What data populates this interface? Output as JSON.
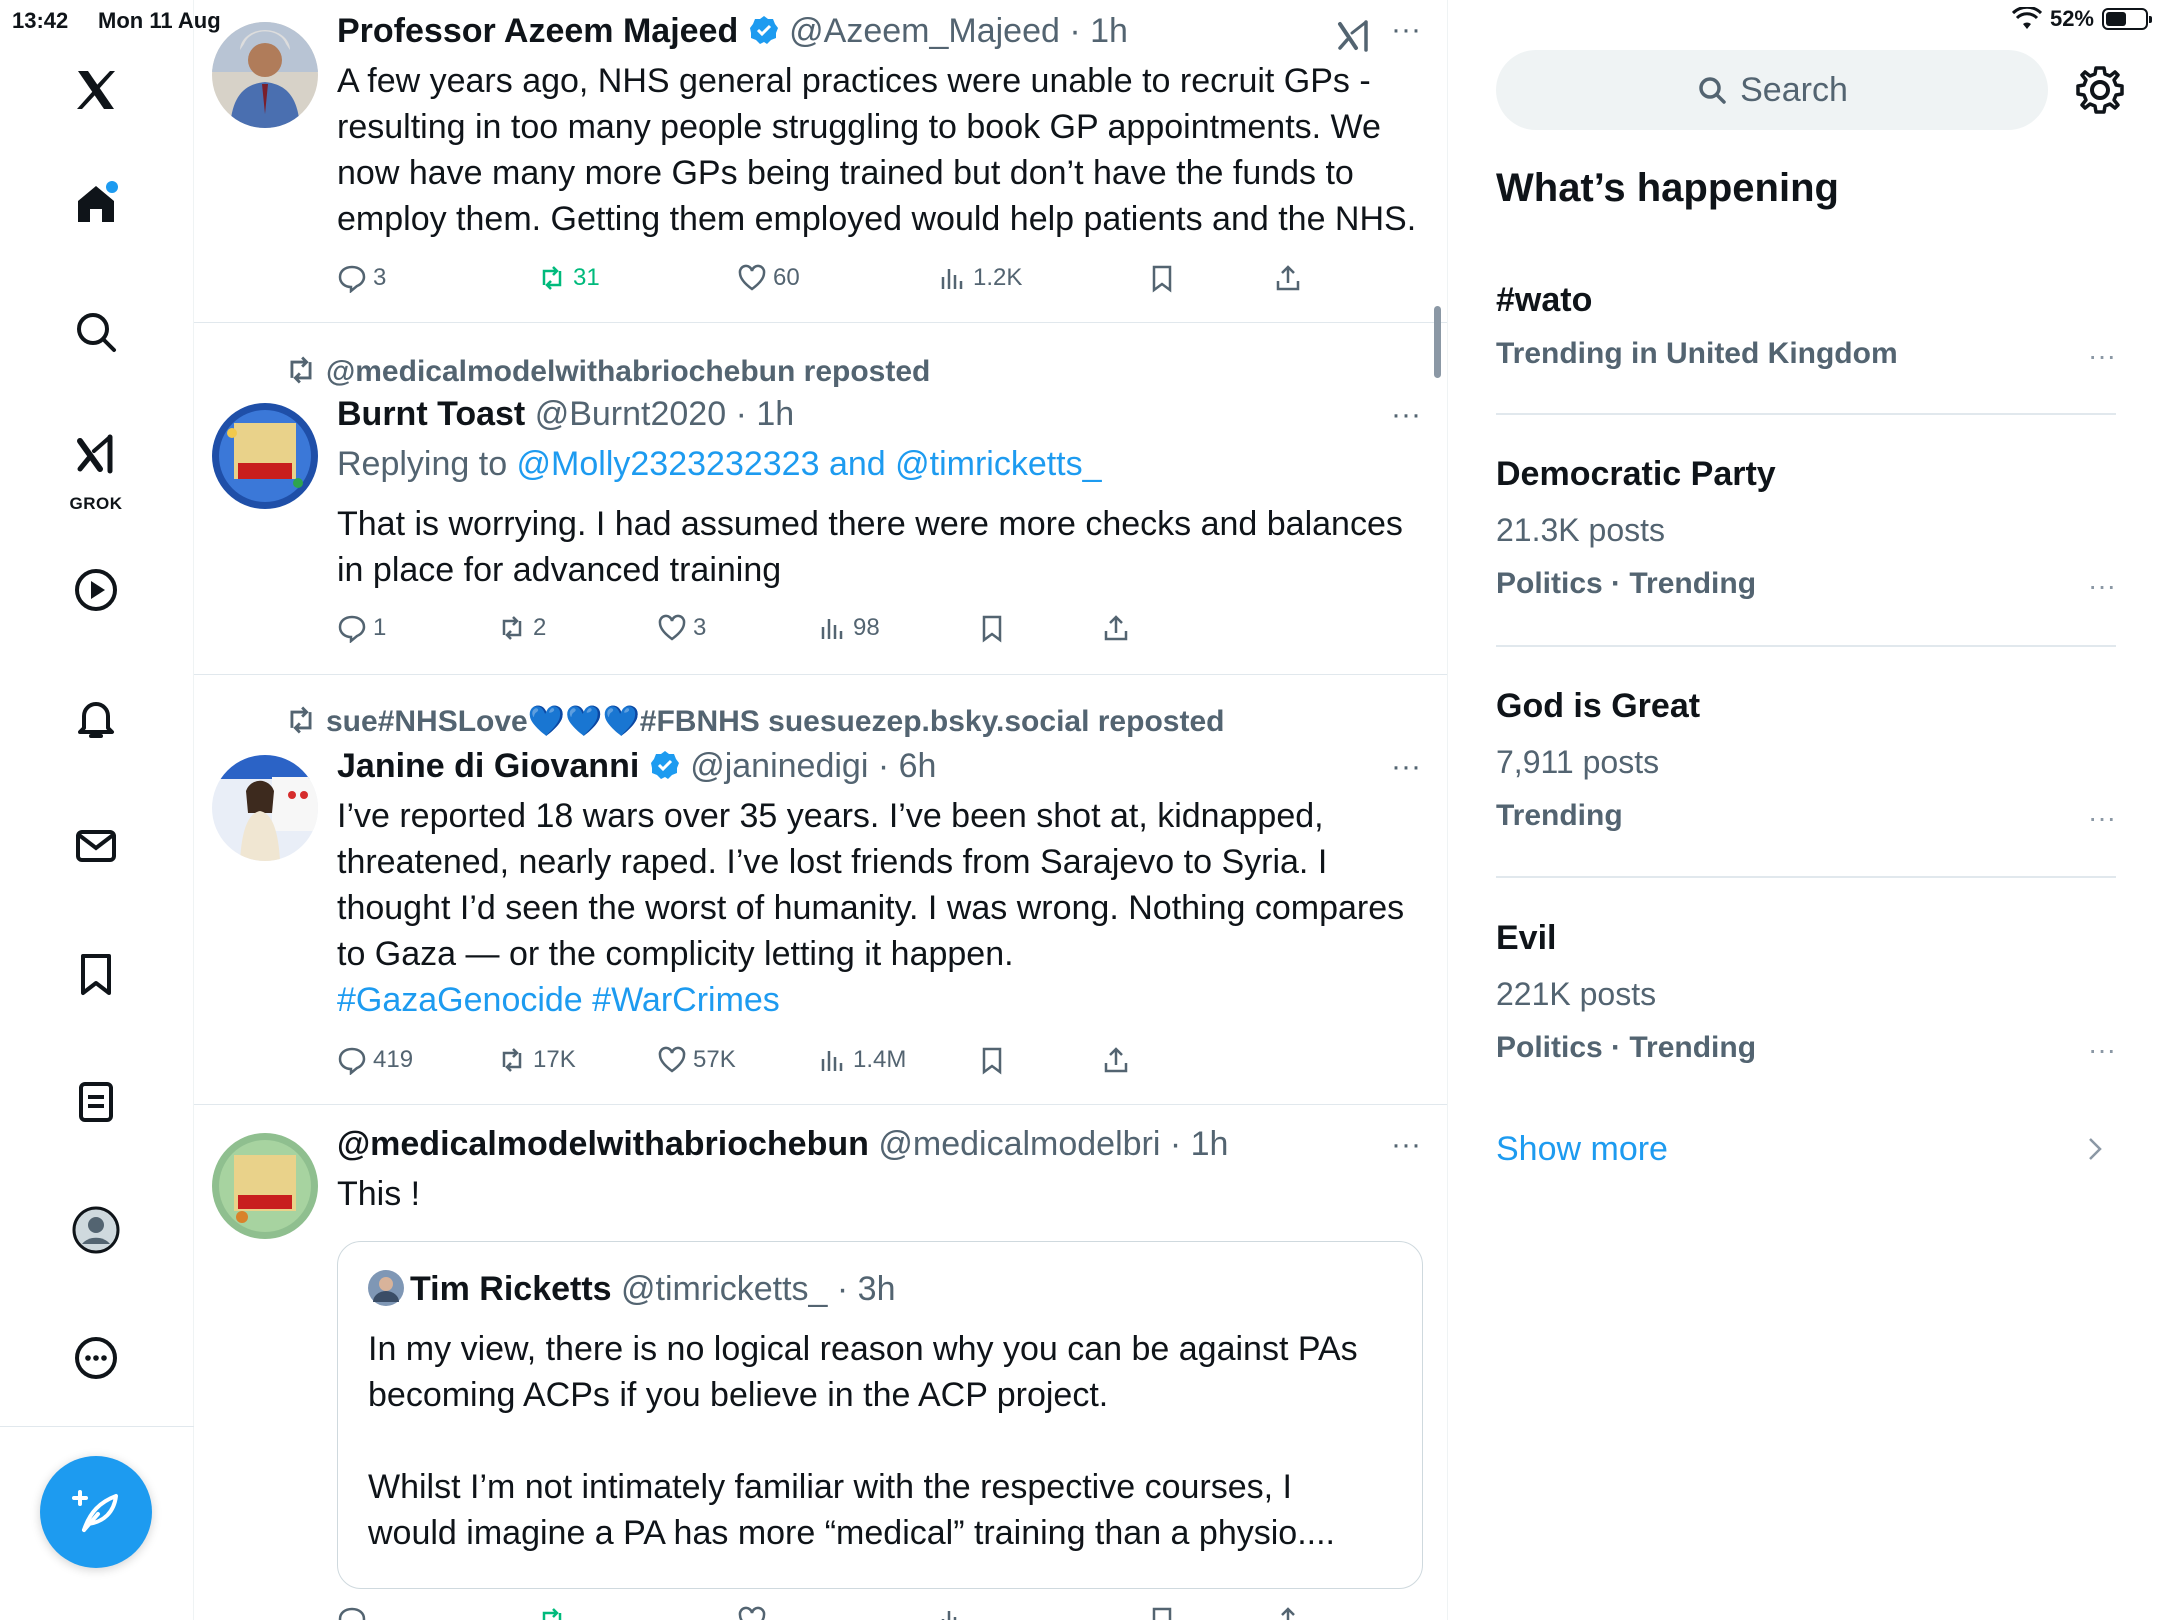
{
  "status_bar": {
    "time": "13:42",
    "date": "Mon 11 Aug",
    "battery": "52%",
    "battery_level": 0.52
  },
  "nav": {
    "grok_label": "GROK",
    "items": [
      "x-logo",
      "home-icon",
      "search-icon",
      "grok-icon",
      "video-icon",
      "notifications-icon",
      "messages-icon",
      "bookmarks-icon",
      "lists-icon",
      "profile-icon",
      "more-icon"
    ],
    "compose": "compose-icon"
  },
  "feed": {
    "posts": [
      {
        "name": "Professor Azeem Majeed",
        "handle": "@Azeem_Majeed",
        "time": "1h",
        "verified": true,
        "text": "A few years ago, NHS general practices were unable to recruit GPs - resulting in too many people struggling to book GP appointments. We now have many more GPs being trained but don’t have the funds to employ them. Getting them employed would help patients and the NHS.",
        "stats": {
          "replies": "3",
          "reposts": "31",
          "likes": "60",
          "views": "1.2K"
        }
      },
      {
        "reposted_by": "@medicalmodelwithabriochebun reposted",
        "name": "Burnt Toast",
        "handle": "@Burnt2020",
        "time": "1h",
        "replying_prefix": "Replying to ",
        "replying_to": "@Molly2323232323 and @timricketts_",
        "text": "That is worrying. I had assumed there were more checks and balances in place for advanced training",
        "stats": {
          "replies": "1",
          "reposts": "2",
          "likes": "3",
          "views": "98"
        }
      },
      {
        "reposted_by": "sue#NHSLove💙💙💙#FBNHS suesuezep.bsky.social reposted",
        "name": "Janine di Giovanni",
        "handle": "@janinedigi",
        "time": "6h",
        "verified": true,
        "text": "I’ve reported 18 wars over 35 years. I’ve been shot at, kidnapped, threatened, nearly raped. I’ve lost friends from Sarajevo to Syria. I thought I’d seen the worst of humanity. I was wrong. Nothing compares to Gaza — or the complicity letting it happen.",
        "hashtags": "#GazaGenocide #WarCrimes",
        "stats": {
          "replies": "419",
          "reposts": "17K",
          "likes": "57K",
          "views": "1.4M"
        }
      },
      {
        "name": "@medicalmodelwithabriochebun",
        "handle": "@medicalmodelbri",
        "time": "1h",
        "text": "This !",
        "quote": {
          "name": "Tim Ricketts",
          "handle": "@timricketts_",
          "time": "3h",
          "text1": "In my view, there is no logical reason why you can be against PAs becoming ACPs if you believe in the ACP project.",
          "text2": "Whilst I’m not intimately familiar with the respective courses, I would imagine a PA has more “medical” training than a physio...."
        }
      }
    ]
  },
  "sidebar": {
    "search_placeholder": "Search",
    "title": "What’s happening",
    "trends": [
      {
        "name": "#wato",
        "meta": "Trending in United Kingdom"
      },
      {
        "name": "Democratic Party",
        "count": "21.3K posts",
        "meta": "Politics · Trending"
      },
      {
        "name": "God is Great",
        "count": "7,911 posts",
        "meta": "Trending"
      },
      {
        "name": "Evil",
        "count": "221K posts",
        "meta": "Politics · Trending"
      }
    ],
    "show_more": "Show more"
  },
  "colors": {
    "accent": "#1d9bf0",
    "repost_green": "#00ba7c",
    "muted": "#536471"
  }
}
